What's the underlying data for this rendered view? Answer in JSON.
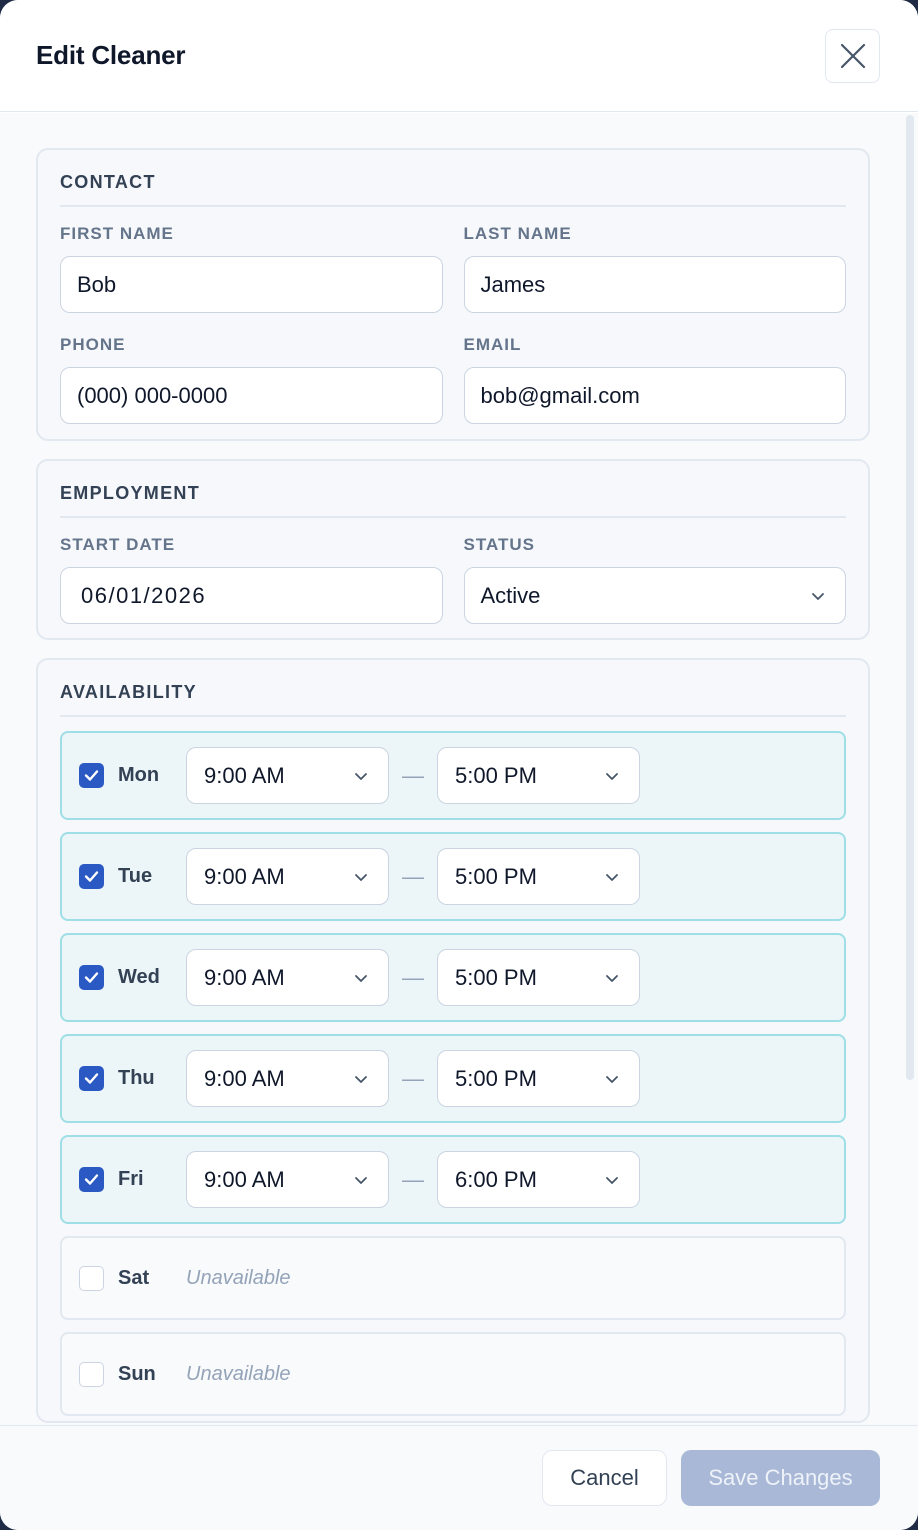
{
  "header": {
    "title": "Edit Cleaner"
  },
  "contact": {
    "title": "CONTACT",
    "first_name_label": "FIRST NAME",
    "first_name_value": "Bob",
    "last_name_label": "LAST NAME",
    "last_name_value": "James",
    "phone_label": "PHONE",
    "phone_value": "(000) 000-0000",
    "email_label": "EMAIL",
    "email_value": "bob@gmail.com"
  },
  "employment": {
    "title": "EMPLOYMENT",
    "start_date_label": "START DATE",
    "start_date_value": "06/01/2026",
    "status_label": "STATUS",
    "status_value": "Active"
  },
  "availability": {
    "title": "AVAILABILITY",
    "separator": "—",
    "days": [
      {
        "day": "Mon",
        "enabled": true,
        "start": "9:00 AM",
        "end": "5:00 PM"
      },
      {
        "day": "Tue",
        "enabled": true,
        "start": "9:00 AM",
        "end": "5:00 PM"
      },
      {
        "day": "Wed",
        "enabled": true,
        "start": "9:00 AM",
        "end": "5:00 PM"
      },
      {
        "day": "Thu",
        "enabled": true,
        "start": "9:00 AM",
        "end": "5:00 PM"
      },
      {
        "day": "Fri",
        "enabled": true,
        "start": "9:00 AM",
        "end": "6:00 PM"
      },
      {
        "day": "Sat",
        "enabled": false,
        "unavailable_text": "Unavailable"
      },
      {
        "day": "Sun",
        "enabled": false,
        "unavailable_text": "Unavailable"
      }
    ]
  },
  "footer": {
    "cancel_label": "Cancel",
    "save_label": "Save Changes"
  },
  "colors": {
    "accent": "#2b59c3",
    "enabled_row_bg": "#ecf5f8",
    "enabled_row_border": "#9edfe6",
    "save_disabled": "#a9b8d6"
  }
}
